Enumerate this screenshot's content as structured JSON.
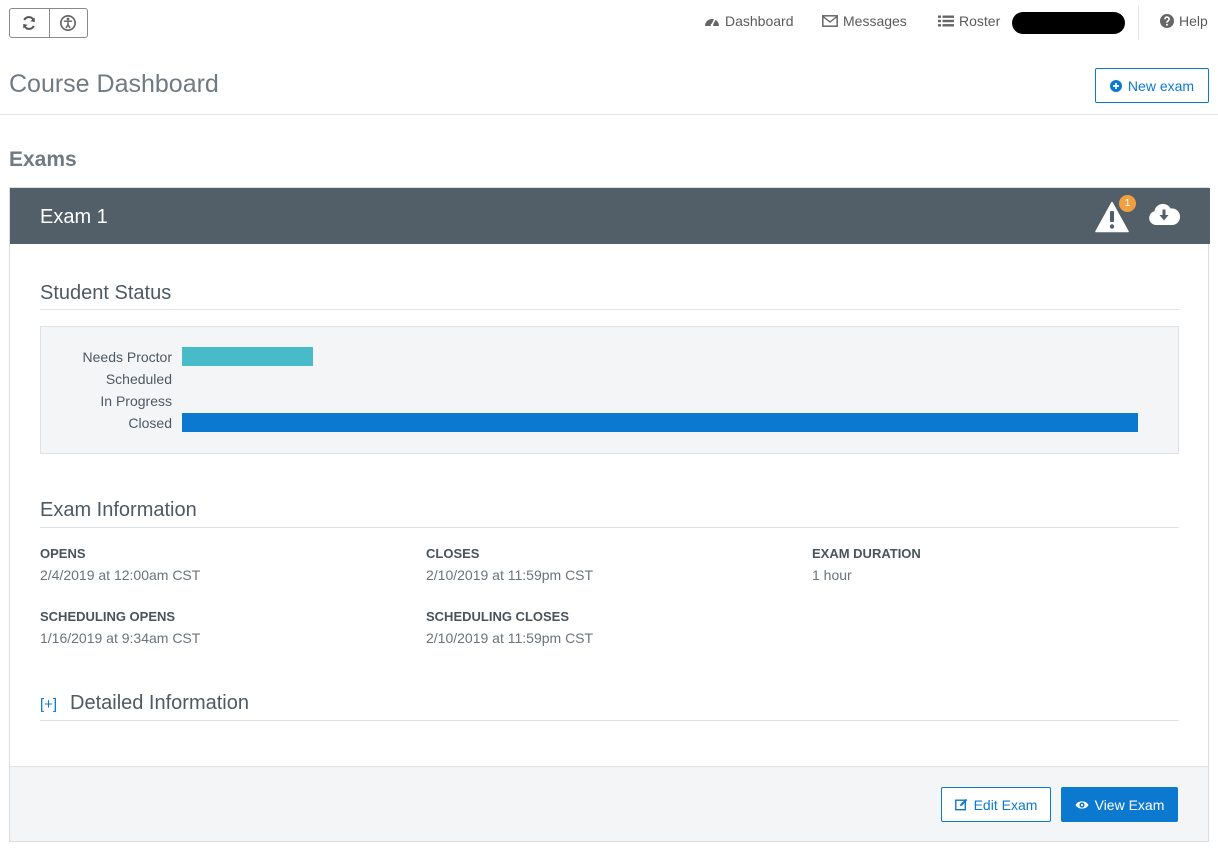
{
  "toolbar": {
    "refresh_icon": "refresh-icon",
    "accessibility_icon": "accessibility-icon"
  },
  "nav": {
    "dashboard": "Dashboard",
    "messages": "Messages",
    "roster": "Roster",
    "help": "Help"
  },
  "header": {
    "title": "Course Dashboard",
    "new_exam_label": "New exam"
  },
  "exams_section": {
    "title": "Exams"
  },
  "exam": {
    "title": "Exam 1",
    "alert_count": "1",
    "student_status": {
      "title": "Student Status"
    },
    "exam_information": {
      "title": "Exam Information",
      "opens_label": "OPENS",
      "opens_value": "2/4/2019 at 12:00am CST",
      "closes_label": "CLOSES",
      "closes_value": "2/10/2019 at 11:59pm CST",
      "duration_label": "EXAM DURATION",
      "duration_value": "1 hour",
      "scheduling_opens_label": "SCHEDULING OPENS",
      "scheduling_opens_value": "1/16/2019 at 9:34am CST",
      "scheduling_closes_label": "SCHEDULING CLOSES",
      "scheduling_closes_value": "2/10/2019 at 11:59pm CST"
    },
    "detailed": {
      "toggle": "[+]",
      "title": "Detailed Information"
    },
    "footer": {
      "edit_label": "Edit Exam",
      "view_label": "View Exam"
    }
  },
  "colors": {
    "accent": "#0b79d0",
    "header_bar": "#525f69",
    "needs_proctor": "#47bcc8",
    "closed": "#0b79d0",
    "badge": "#f0a040"
  },
  "chart_data": {
    "type": "bar",
    "orientation": "horizontal",
    "categories": [
      "Needs Proctor",
      "Scheduled",
      "In Progress",
      "Closed"
    ],
    "values": [
      0.137,
      0,
      0,
      1
    ],
    "colors": [
      "#47bcc8",
      "#0b79d0",
      "#0b79d0",
      "#0b79d0"
    ],
    "grid": false
  }
}
